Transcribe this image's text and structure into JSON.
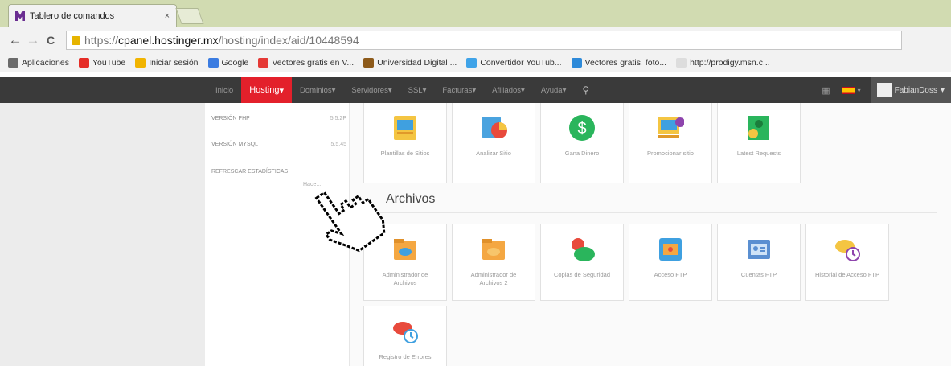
{
  "browser": {
    "tab_title": "Tablero de comandos",
    "tab_close": "×",
    "url_scheme": "https://",
    "url_host": "cpanel.hostinger.mx",
    "url_path": "/hosting/index/aid/10448594",
    "back": "←",
    "forward": "→",
    "reload": "C"
  },
  "bookmarks": [
    {
      "label": "Aplicaciones",
      "color": "#6b6b6b"
    },
    {
      "label": "YouTube",
      "color": "#e52d27"
    },
    {
      "label": "Iniciar sesión",
      "color": "#f1b400"
    },
    {
      "label": "Google",
      "color": "#3b7ce1"
    },
    {
      "label": "Vectores gratis en V...",
      "color": "#e53935"
    },
    {
      "label": "Universidad Digital ...",
      "color": "#8d5a1a"
    },
    {
      "label": "Convertidor YouTub...",
      "color": "#3fa3e8"
    },
    {
      "label": "Vectores gratis, foto...",
      "color": "#2e8ad9"
    },
    {
      "label": "http://prodigy.msn.c...",
      "color": "#dddddd"
    }
  ],
  "nav": {
    "items": [
      "Inicio",
      "Hosting",
      "Dominios",
      "Servidores",
      "SSL",
      "Facturas",
      "Afiliados",
      "Ayuda"
    ],
    "active": "Hosting",
    "user": "FabianDoss"
  },
  "sidepanel": {
    "php_label": "VERSIÓN PHP",
    "php_value": "5.5.2P",
    "mysql_label": "VERSIÓN MYSQL",
    "mysql_value": "5.5.45",
    "refresh_label": "REFRESCAR ESTADÍSTICAS",
    "refresh_hint": "Hace..."
  },
  "top_cards": [
    {
      "label": "Plantillas de Sitios",
      "icon": "site-templates-icon"
    },
    {
      "label": "Analizar Sitio",
      "icon": "analyze-site-icon"
    },
    {
      "label": "Gana Dinero",
      "icon": "money-icon"
    },
    {
      "label": "Promocionar sitio",
      "icon": "promote-icon"
    },
    {
      "label": "Latest Requests",
      "icon": "requests-icon"
    }
  ],
  "section_title": "Archivos",
  "file_cards": [
    {
      "label": "Administrador de Archivos",
      "icon": "file-manager-icon"
    },
    {
      "label": "Administrador de Archivos 2",
      "icon": "file-manager-2-icon"
    },
    {
      "label": "Copias de Seguridad",
      "icon": "backup-icon"
    },
    {
      "label": "Acceso FTP",
      "icon": "ftp-access-icon"
    },
    {
      "label": "Cuentas FTP",
      "icon": "ftp-accounts-icon"
    },
    {
      "label": "Historial de Acceso FTP",
      "icon": "ftp-history-icon"
    },
    {
      "label": "Registro de Errores",
      "icon": "error-log-icon"
    }
  ]
}
